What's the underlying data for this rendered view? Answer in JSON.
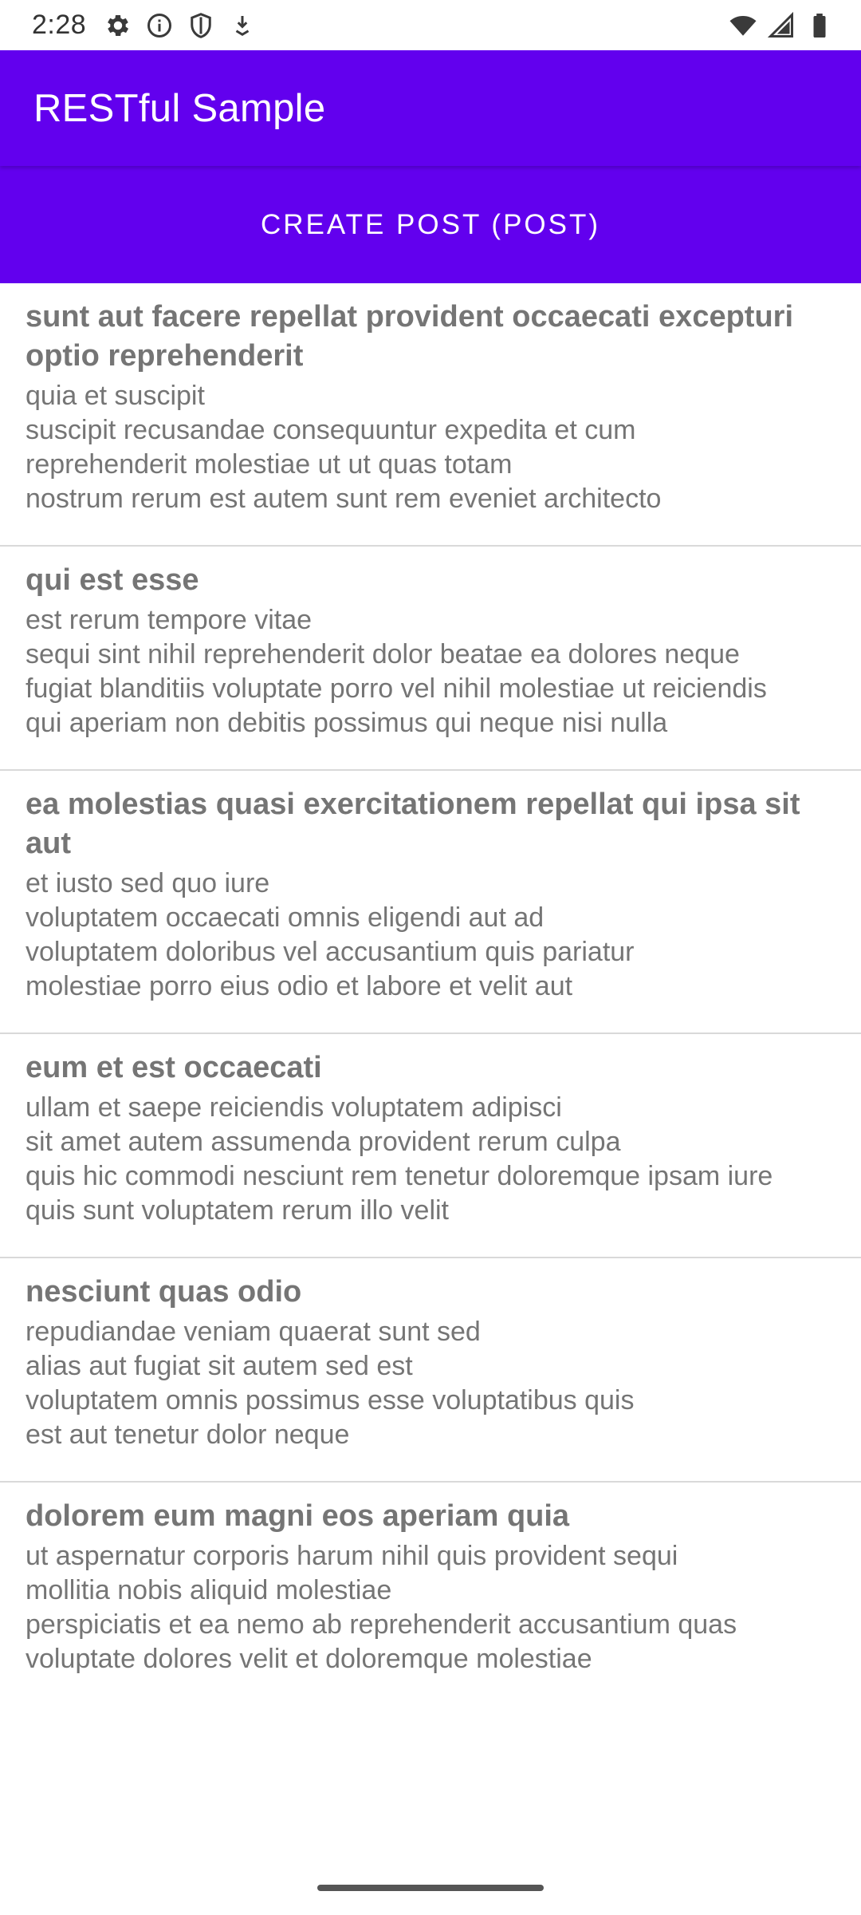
{
  "status_bar": {
    "time": "2:28",
    "left_icons": [
      "settings-icon",
      "info-icon",
      "shield-icon",
      "download-icon"
    ],
    "right_icons": [
      "wifi-icon",
      "signal-icon",
      "battery-icon"
    ]
  },
  "app_bar": {
    "title": "RESTful Sample",
    "color": "#6200ee"
  },
  "create_button": {
    "label": "CREATE POST (POST)"
  },
  "posts": [
    {
      "title": "sunt aut facere repellat provident occaecati excepturi optio reprehenderit",
      "body": "quia et suscipit\nsuscipit recusandae consequuntur expedita et cum\nreprehenderit molestiae ut ut quas totam\nnostrum rerum est autem sunt rem eveniet architecto"
    },
    {
      "title": "qui est esse",
      "body": "est rerum tempore vitae\nsequi sint nihil reprehenderit dolor beatae ea dolores neque\nfugiat blanditiis voluptate porro vel nihil molestiae ut reiciendis\nqui aperiam non debitis possimus qui neque nisi nulla"
    },
    {
      "title": "ea molestias quasi exercitationem repellat qui ipsa sit aut",
      "body": "et iusto sed quo iure\nvoluptatem occaecati omnis eligendi aut ad\nvoluptatem doloribus vel accusantium quis pariatur\nmolestiae porro eius odio et labore et velit aut"
    },
    {
      "title": "eum et est occaecati",
      "body": "ullam et saepe reiciendis voluptatem adipisci\nsit amet autem assumenda provident rerum culpa\nquis hic commodi nesciunt rem tenetur doloremque ipsam iure\nquis sunt voluptatem rerum illo velit"
    },
    {
      "title": "nesciunt quas odio",
      "body": "repudiandae veniam quaerat sunt sed\nalias aut fugiat sit autem sed est\nvoluptatem omnis possimus esse voluptatibus quis\nest aut tenetur dolor neque"
    },
    {
      "title": "dolorem eum magni eos aperiam quia",
      "body": "ut aspernatur corporis harum nihil quis provident sequi\nmollitia nobis aliquid molestiae\nperspiciatis et ea nemo ab reprehenderit accusantium quas\nvoluptate dolores velit et doloremque molestiae"
    }
  ]
}
